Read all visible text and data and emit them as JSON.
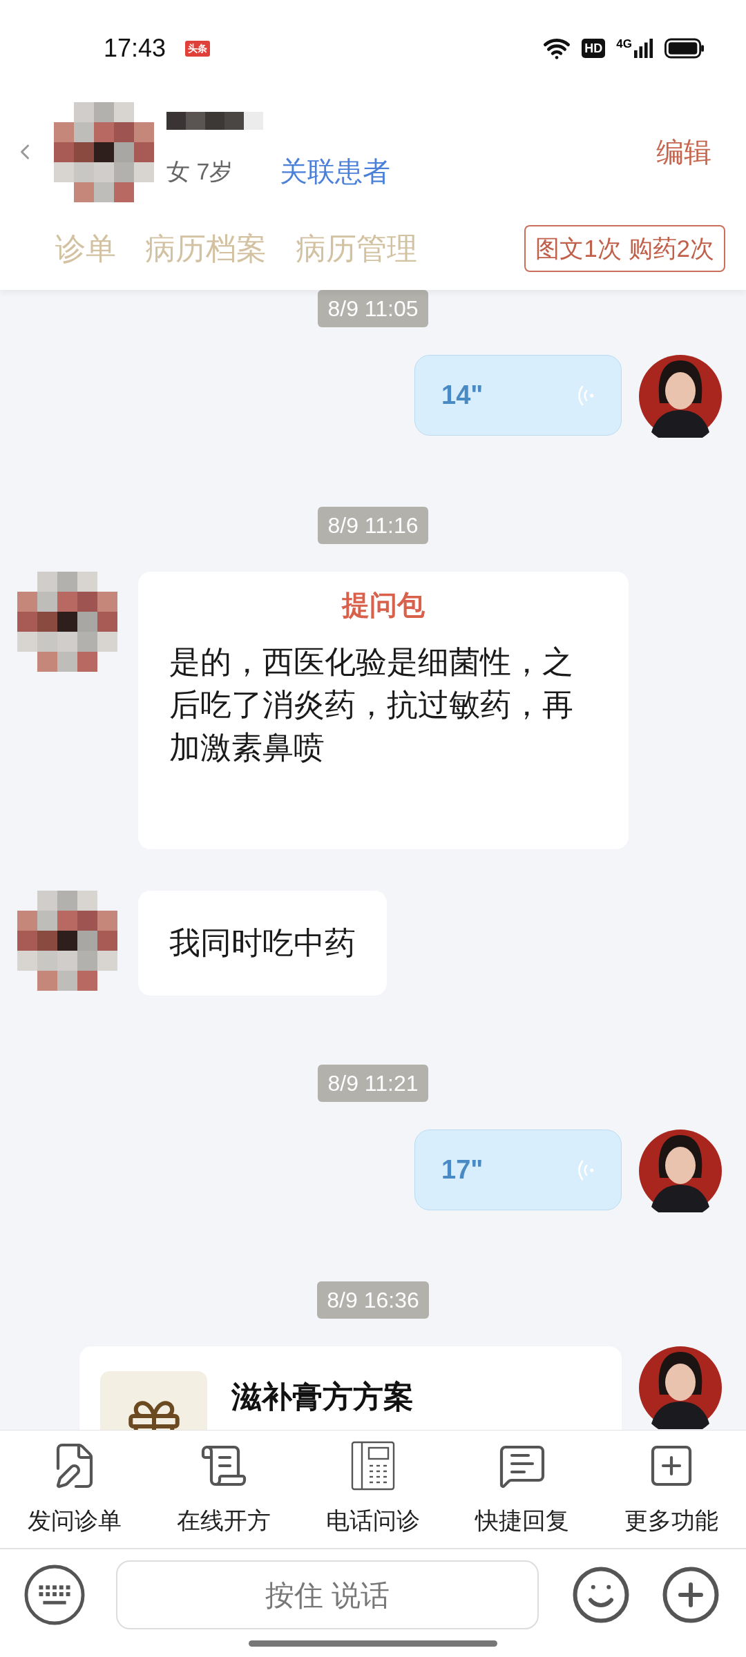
{
  "status_bar": {
    "time": "17:43",
    "app_badge": "头条",
    "hd": "HD",
    "network": "4G"
  },
  "header": {
    "info": "女 7岁",
    "link": "关联患者",
    "edit": "编辑"
  },
  "tabs": [
    "诊单",
    "病历档案",
    "病历管理"
  ],
  "service_tag": "图文1次 购药2次",
  "messages": [
    {
      "kind": "time",
      "text": "8/9 11:05"
    },
    {
      "kind": "voice",
      "outgoing": true,
      "duration": "14\""
    },
    {
      "kind": "time",
      "text": "8/9 11:16"
    },
    {
      "kind": "question",
      "outgoing": false,
      "title": "提问包",
      "text": "是的，西医化验是细菌性，之后吃了消炎药，抗过敏药，再加激素鼻喷"
    },
    {
      "kind": "text",
      "outgoing": false,
      "text": "我同时吃中药"
    },
    {
      "kind": "time",
      "text": "8/9 11:21"
    },
    {
      "kind": "voice",
      "outgoing": true,
      "duration": "17\""
    },
    {
      "kind": "time",
      "text": "8/9 16:36"
    },
    {
      "kind": "card",
      "outgoing": true,
      "title": "滋补膏方方案"
    }
  ],
  "toolbar": [
    {
      "kind": "form",
      "label": "发问诊单"
    },
    {
      "kind": "prescribe",
      "label": "在线开方"
    },
    {
      "kind": "phone",
      "label": "电话问诊"
    },
    {
      "kind": "reply",
      "label": "快捷回复"
    },
    {
      "kind": "more",
      "label": "更多功能"
    }
  ],
  "input": {
    "hold_to_talk": "按住 说话"
  }
}
